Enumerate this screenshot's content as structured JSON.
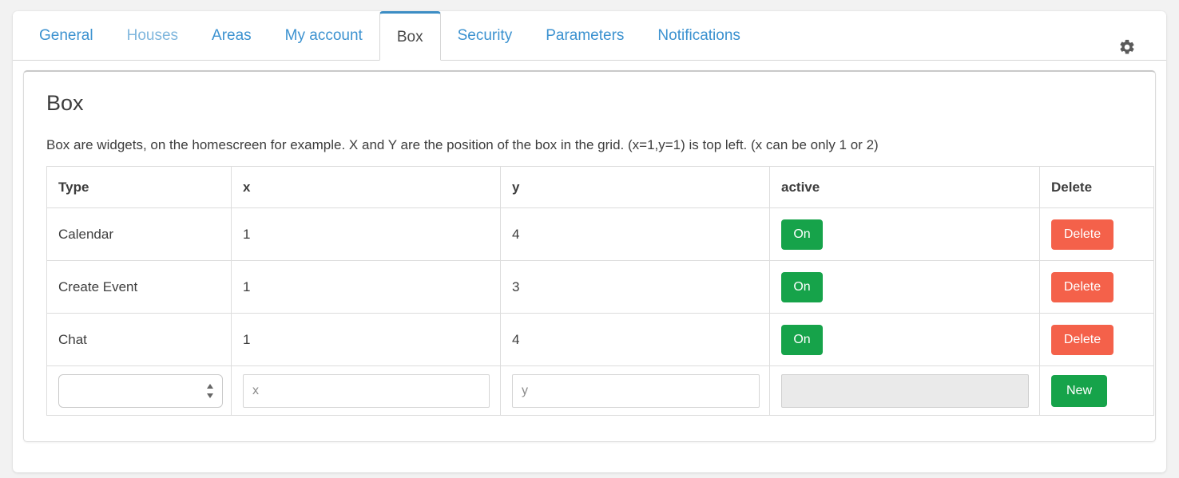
{
  "tabs": [
    {
      "label": "General",
      "state": "normal"
    },
    {
      "label": "Houses",
      "state": "muted"
    },
    {
      "label": "Areas",
      "state": "normal"
    },
    {
      "label": "My account",
      "state": "normal"
    },
    {
      "label": "Box",
      "state": "active"
    },
    {
      "label": "Security",
      "state": "normal"
    },
    {
      "label": "Parameters",
      "state": "normal"
    },
    {
      "label": "Notifications",
      "state": "normal"
    }
  ],
  "settings_icon": "gear-icon",
  "panel": {
    "title": "Box",
    "description": "Box are widgets, on the homescreen for example. X and Y are the position of the box in the grid. (x=1,y=1) is top left. (x can be only 1 or 2)"
  },
  "table": {
    "headers": {
      "type": "Type",
      "x": "x",
      "y": "y",
      "active": "active",
      "delete": "Delete"
    },
    "rows": [
      {
        "type": "Calendar",
        "x": "1",
        "y": "4",
        "active_label": "On",
        "delete_label": "Delete"
      },
      {
        "type": "Create Event",
        "x": "1",
        "y": "3",
        "active_label": "On",
        "delete_label": "Delete"
      },
      {
        "type": "Chat",
        "x": "1",
        "y": "4",
        "active_label": "On",
        "delete_label": "Delete"
      }
    ],
    "new_row": {
      "type_value": "",
      "x_value": "",
      "x_placeholder": "x",
      "y_value": "",
      "y_placeholder": "y",
      "active_value": "",
      "new_label": "New"
    }
  },
  "colors": {
    "accent_blue": "#3c92d0",
    "active_tab_underline": "#3c8dc4",
    "green": "#16a34a",
    "red": "#f4614a",
    "page_bg": "#f2f2f2",
    "text": "#3d3d3d"
  }
}
